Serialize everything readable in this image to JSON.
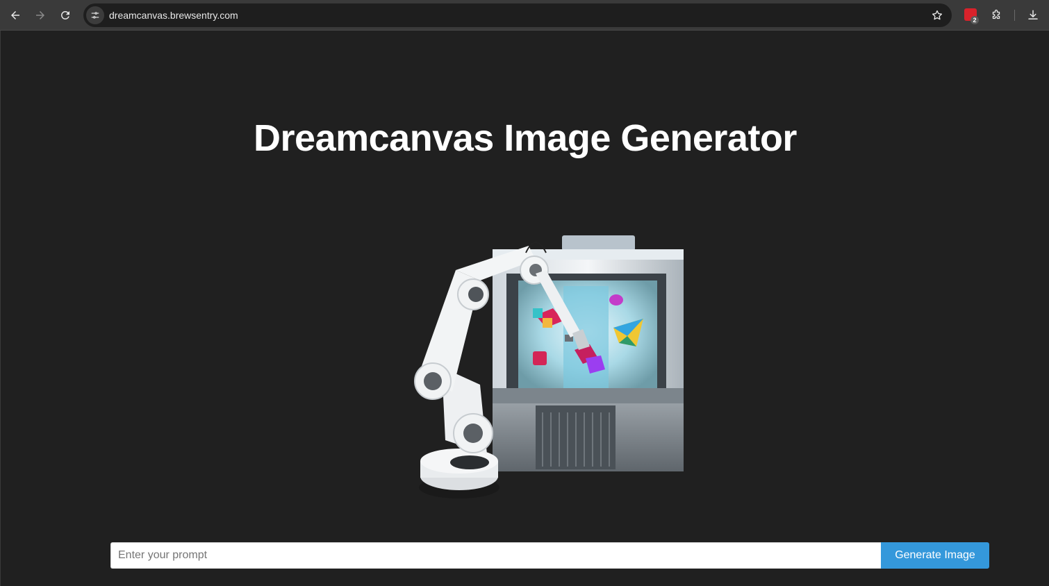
{
  "browser": {
    "url": "dreamcanvas.brewsentry.com",
    "extension_badge_count": "2",
    "icons": [
      "back-arrow-icon",
      "forward-arrow-icon",
      "reload-icon",
      "site-info-icon",
      "bookmark-star-icon",
      "extension-icon",
      "puzzle-icon",
      "download-icon"
    ]
  },
  "page": {
    "title": "Dreamcanvas Image Generator",
    "hero_image": "robot-arm-generator-illustration",
    "prompt": {
      "placeholder": "Enter your prompt",
      "value": ""
    },
    "generate_button_label": "Generate Image"
  },
  "colors": {
    "page_background": "#202020",
    "button_primary": "#3498db",
    "title_text": "#ffffff"
  }
}
